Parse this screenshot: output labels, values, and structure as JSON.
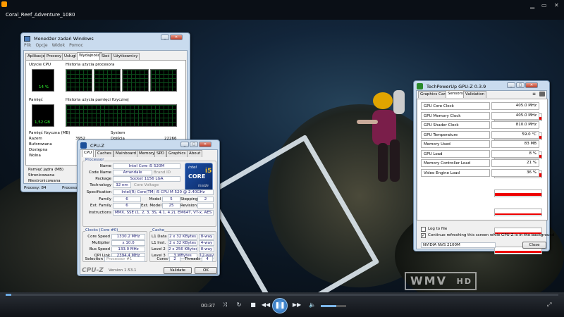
{
  "player": {
    "title": "Coral_Reef_Adventure_1080",
    "time": "00:37",
    "progress": 0.01,
    "volume": 0.6,
    "watermark": "WMV",
    "watermark_hd": "HD"
  },
  "taskmgr": {
    "title": "Menedżer zadań Windows",
    "menu": [
      "Plik",
      "Opcje",
      "Widok",
      "Pomoc"
    ],
    "tabs": [
      "Aplikacje",
      "Procesy",
      "Usługi",
      "Wydajność",
      "Sieć",
      "Użytkownicy"
    ],
    "cpu_usage_label": "Użycie CPU",
    "cpu_usage_value": "14 %",
    "cpu_history_label": "Historia użycia procesora",
    "mem_label": "Pamięć",
    "mem_value": "1,52 GB",
    "mem_history_label": "Historia użycia pamięci fizycznej",
    "phys_mem_label": "Pamięć fizyczna (MB)",
    "phys_rows": [
      {
        "k": "Razem",
        "v": "3952"
      },
      {
        "k": "Buforowana",
        "v": ""
      },
      {
        "k": "Dostępna",
        "v": ""
      },
      {
        "k": "Wolna",
        "v": ""
      }
    ],
    "system_label": "System",
    "system_rows": [
      {
        "k": "Dojścia",
        "v": "22266"
      }
    ],
    "kernel_label": "Pamięć jądra (MB)",
    "kernel_rows": [
      {
        "k": "Stronicowana",
        "v": ""
      },
      {
        "k": "Niestronicowana",
        "v": ""
      }
    ],
    "status_processes": "Procesy: 84",
    "status_cpu": "Procesor"
  },
  "cpuz": {
    "title": "CPU-Z",
    "tabs": [
      "CPU",
      "Caches",
      "Mainboard",
      "Memory",
      "SPD",
      "Graphics",
      "About"
    ],
    "processor_group": "Processor",
    "name_label": "Name",
    "name": "Intel Core i5 520M",
    "codename_label": "Code Name",
    "codename": "Arrandale",
    "brandid_label": "Brand ID",
    "package_label": "Package",
    "package": "Socket 1156 LGA",
    "technology_label": "Technology",
    "technology": "32 nm",
    "corevoltage_label": "Core Voltage",
    "spec_label": "Specification",
    "spec": "Intel(R) Core(TM) i5 CPU       M 520  @ 2.40GHz",
    "family_label": "Family",
    "family": "6",
    "model_label": "Model",
    "model": "5",
    "stepping_label": "Stepping",
    "stepping": "2",
    "extfamily_label": "Ext. Family",
    "extfamily": "6",
    "extmodel_label": "Ext. Model",
    "extmodel": "25",
    "revision_label": "Revision",
    "instr_label": "Instructions",
    "instr": "MMX, SSE (1, 2, 3, 3S, 4.1, 4.2), EM64T, VT-x, AES",
    "clocks_group": "Clocks (Core #0)",
    "corespeed_label": "Core Speed",
    "corespeed": "1330.2 MHz",
    "multiplier_label": "Multiplier",
    "multiplier": "x 10.0",
    "busspeed_label": "Bus Speed",
    "busspeed": "133.0 MHz",
    "qpi_label": "QPI Link",
    "qpi": "2394.4 MHz",
    "cache_group": "Cache",
    "caches": [
      {
        "k": "L1 Data",
        "v": "2 x 32 KBytes",
        "w": "8-way"
      },
      {
        "k": "L1 Inst.",
        "v": "2 x 32 KBytes",
        "w": "4-way"
      },
      {
        "k": "Level 2",
        "v": "2 x 256 KBytes",
        "w": "8-way"
      },
      {
        "k": "Level 3",
        "v": "3 MBytes",
        "w": "12-way"
      }
    ],
    "selection_label": "Selection",
    "selection": "Processor #1",
    "cores_label": "Cores",
    "cores": "2",
    "threads_label": "Threads",
    "threads": "4",
    "brand": "CPU-Z",
    "version": "Version 1.53.1",
    "validate": "Validate",
    "ok": "OK",
    "logo_line1": "intel",
    "logo_core": "CORE",
    "logo_i5": "i5",
    "logo_inside": "inside"
  },
  "gpuz": {
    "title": "TechPowerUp GPU-Z 0.3.9",
    "tabs": [
      "Graphics Card",
      "Sensors",
      "Validation"
    ],
    "sensors": [
      {
        "k": "GPU Core Clock",
        "v": "405.0 MHz",
        "level": 0.55
      },
      {
        "k": "GPU Memory Clock",
        "v": "405.0 MHz",
        "level": 0.55
      },
      {
        "k": "GPU Shader Clock",
        "v": "810.0 MHz",
        "level": 0.55
      },
      {
        "k": "GPU Temperature",
        "v": "59.0 °C",
        "level": 0.6
      },
      {
        "k": "Memory Used",
        "v": "83 MB",
        "level": 0.45
      },
      {
        "k": "GPU Load",
        "v": "8 %",
        "level": 0.08
      },
      {
        "k": "Memory Controller Load",
        "v": "21 %",
        "level": 0.21
      },
      {
        "k": "Video Engine Load",
        "v": "36 %",
        "level": 0.36
      }
    ],
    "log_label": "Log to file",
    "continue_label": "Continue refreshing this screen while GPU-Z is in the background",
    "device": "NVIDIA NVS 2100M",
    "close": "Close"
  }
}
